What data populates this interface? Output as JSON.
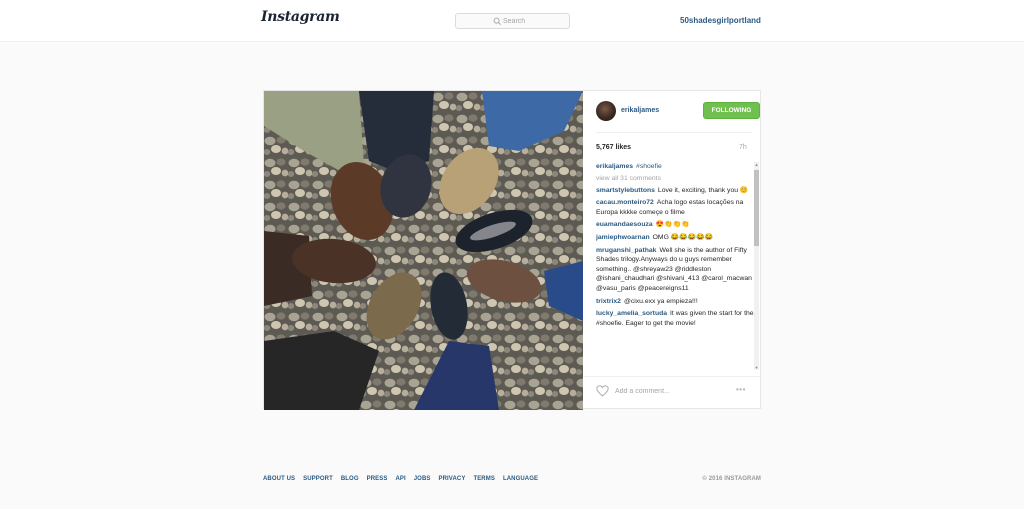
{
  "header": {
    "logo": "Instagram",
    "search_placeholder": "Search",
    "username_link": "50shadesgirlportland"
  },
  "post": {
    "author": "erikaljames",
    "follow_label": "FOLLOWING",
    "likes": "5,767 likes",
    "time": "7h",
    "caption": {
      "author": "erikaljames",
      "text": "#shoefie"
    },
    "view_all": "view all 31 comments",
    "comments": [
      {
        "author": "smartstylebuttons",
        "text": "Love it, exciting, thank you 😊"
      },
      {
        "author": "cacau.monteiro72",
        "text": "Acha logo estas locações na Europa kkkke começe o filme"
      },
      {
        "author": "euamandaesouza",
        "text": "😍👏👏👏"
      },
      {
        "author": "jamiephwoarnan",
        "text": "OMG 😂😂😂😂😂"
      },
      {
        "author": "mruganshi_pathak",
        "text": "Well she is the author of Fifty Shades trilogy.Anyways do u guys remember something.. @shreyaw23 @riddleston @ishani_chaudhari @shivani_413 @carol_macwan @vasu_paris @peacereigns11"
      },
      {
        "author": "trixtrix2",
        "text": "@cixu.exx ya empieza!!!"
      },
      {
        "author": "lucky_amelia_sortuda",
        "text": "It was given the start for the #shoefie. Eager to get the movie!"
      }
    ],
    "add_comment_placeholder": "Add a comment...",
    "more_label": "•••"
  },
  "footer": {
    "links": [
      "ABOUT US",
      "SUPPORT",
      "BLOG",
      "PRESS",
      "API",
      "JOBS",
      "PRIVACY",
      "TERMS",
      "LANGUAGE"
    ],
    "copyright": "© 2016 INSTAGRAM"
  },
  "colors": {
    "link": "#2b5a83",
    "follow_green": "#70c050",
    "background": "#fafafa"
  },
  "icons": [
    "search-icon",
    "heart-icon",
    "more-options-icon"
  ]
}
